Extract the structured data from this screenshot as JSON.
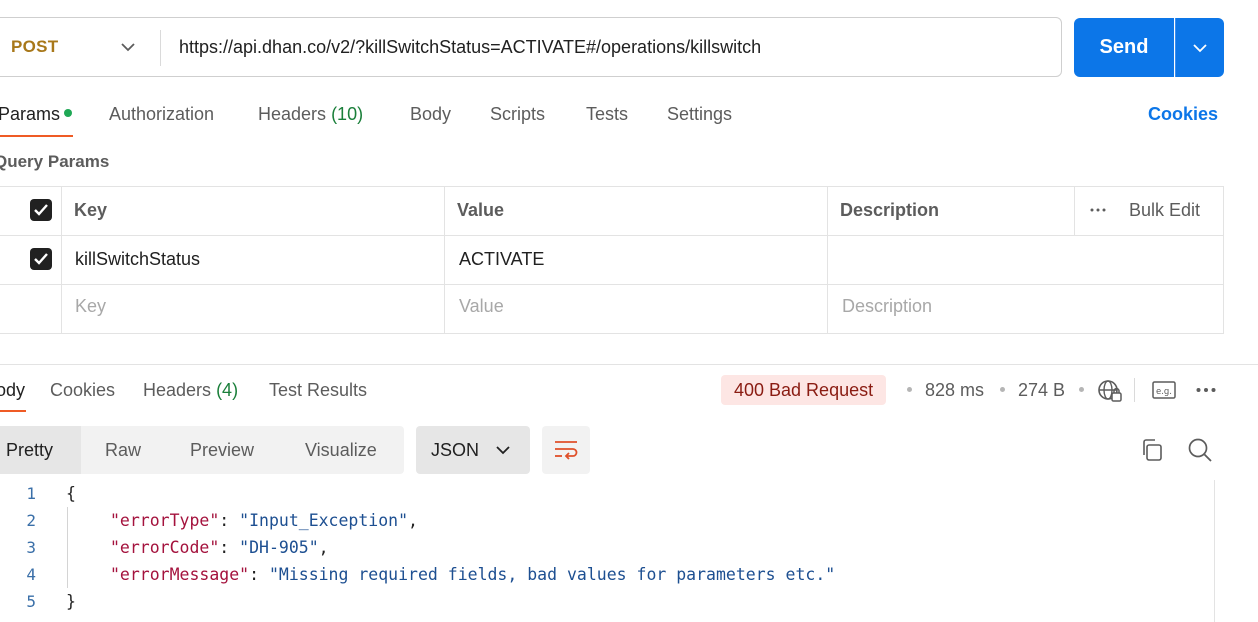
{
  "request": {
    "method": "POST",
    "url": "https://api.dhan.co/v2/?killSwitchStatus=ACTIVATE#/operations/killswitch",
    "send_label": "Send"
  },
  "request_tabs": {
    "params": "Params",
    "authorization": "Authorization",
    "headers": "Headers",
    "headers_count": "(10)",
    "body": "Body",
    "scripts": "Scripts",
    "tests": "Tests",
    "settings": "Settings",
    "cookies": "Cookies"
  },
  "query_params": {
    "title": "Query Params",
    "columns": {
      "key": "Key",
      "value": "Value",
      "description": "Description",
      "bulk_edit": "Bulk Edit"
    },
    "rows": [
      {
        "checked": true,
        "key": "killSwitchStatus",
        "value": "ACTIVATE",
        "description": ""
      }
    ],
    "placeholders": {
      "key": "Key",
      "value": "Value",
      "description": "Description"
    }
  },
  "response_tabs": {
    "body": "Body",
    "cookies": "Cookies",
    "headers": "Headers",
    "headers_count": "(4)",
    "test_results": "Test Results"
  },
  "response_meta": {
    "status": "400 Bad Request",
    "time": "828 ms",
    "size": "274 B"
  },
  "view": {
    "options": [
      "Pretty",
      "Raw",
      "Preview",
      "Visualize"
    ],
    "format": "JSON"
  },
  "code": {
    "line_numbers": [
      "1",
      "2",
      "3",
      "4",
      "5"
    ],
    "open": "{",
    "close": "}",
    "entries": [
      {
        "key": "\"errorType\"",
        "value": "\"Input_Exception\"",
        "trail": ","
      },
      {
        "key": "\"errorCode\"",
        "value": "\"DH-905\"",
        "trail": ","
      },
      {
        "key": "\"errorMessage\"",
        "value": "\"Missing required fields, bad values for parameters etc.\"",
        "trail": ""
      }
    ]
  },
  "colors": {
    "accent": "#0c76e8",
    "method": "#a8781a",
    "active_tab": "#ef5b25",
    "status_bg": "#fde6e4",
    "status_text": "#8a1c12",
    "count_green": "#1a7f3a"
  }
}
